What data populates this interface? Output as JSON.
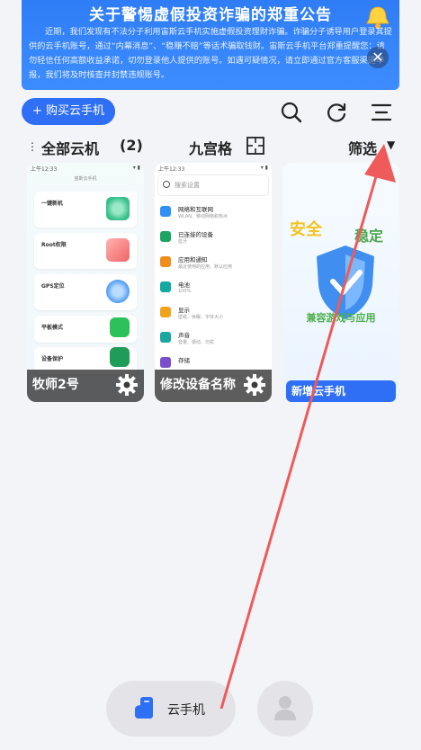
{
  "banner": {
    "title": "关于警惕虚假投资诈骗的郑重公告",
    "body": "近期，我们发现有不法分子利用宙斯云手机实施虚假投资理财诈骗。诈骗分子诱导用户登录其提供的云手机账号，通过“内幕消息”、“稳赚不赔”等话术骗取钱财。宙斯云手机平台郑重提醒您：请勿轻信任何高额收益承诺，切勿登录他人提供的账号。如遇可疑情况，请立即通过官方客服渠道举报，我们将及时核查并封禁违规账号。"
  },
  "toolbar": {
    "buy_label": "+ 购买云手机",
    "icons": [
      "search-icon",
      "refresh-icon",
      "menu-icon"
    ]
  },
  "group": {
    "label": "全部云机",
    "count": "(2)",
    "grid_label": "九宫格",
    "filter_label": "筛选"
  },
  "cards": [
    {
      "name": "牧师2号",
      "status_time": "上午12:33",
      "screen_heading": "宙斯云手机",
      "tiles": [
        "一键新机",
        "Root权限",
        "GPS定位",
        "平板模式",
        "设备保护"
      ]
    },
    {
      "name": "修改设备名称",
      "status_time": "上午12:33",
      "search_placeholder": "搜索设置",
      "settings": [
        {
          "title": "网络和互联网",
          "sub": "WLAN、移动网络和热点",
          "color": "#2f8ff5"
        },
        {
          "title": "已连接的设备",
          "sub": "蓝牙",
          "color": "#1ea462"
        },
        {
          "title": "应用和通知",
          "sub": "最近使用的应用、默认应用",
          "color": "#f08c1b"
        },
        {
          "title": "电池",
          "sub": "100%",
          "color": "#12a9a2"
        },
        {
          "title": "显示",
          "sub": "壁纸、休眠、字体大小",
          "color": "#f2a31b"
        },
        {
          "title": "声音",
          "sub": "音量、振动、勿扰",
          "color": "#19a7a0"
        },
        {
          "title": "存储",
          "sub": "",
          "color": "#7b4fcc"
        }
      ]
    },
    {
      "title": "安全",
      "title2": "稳定",
      "subtitle": "兼容游戏与应用",
      "add_label": "新增云手机"
    }
  ],
  "bottom_nav": {
    "cloud_phone_label": "云手机"
  },
  "colors": {
    "accent": "#2f6ff5",
    "annotation_arrow": "#ef5a5a"
  }
}
